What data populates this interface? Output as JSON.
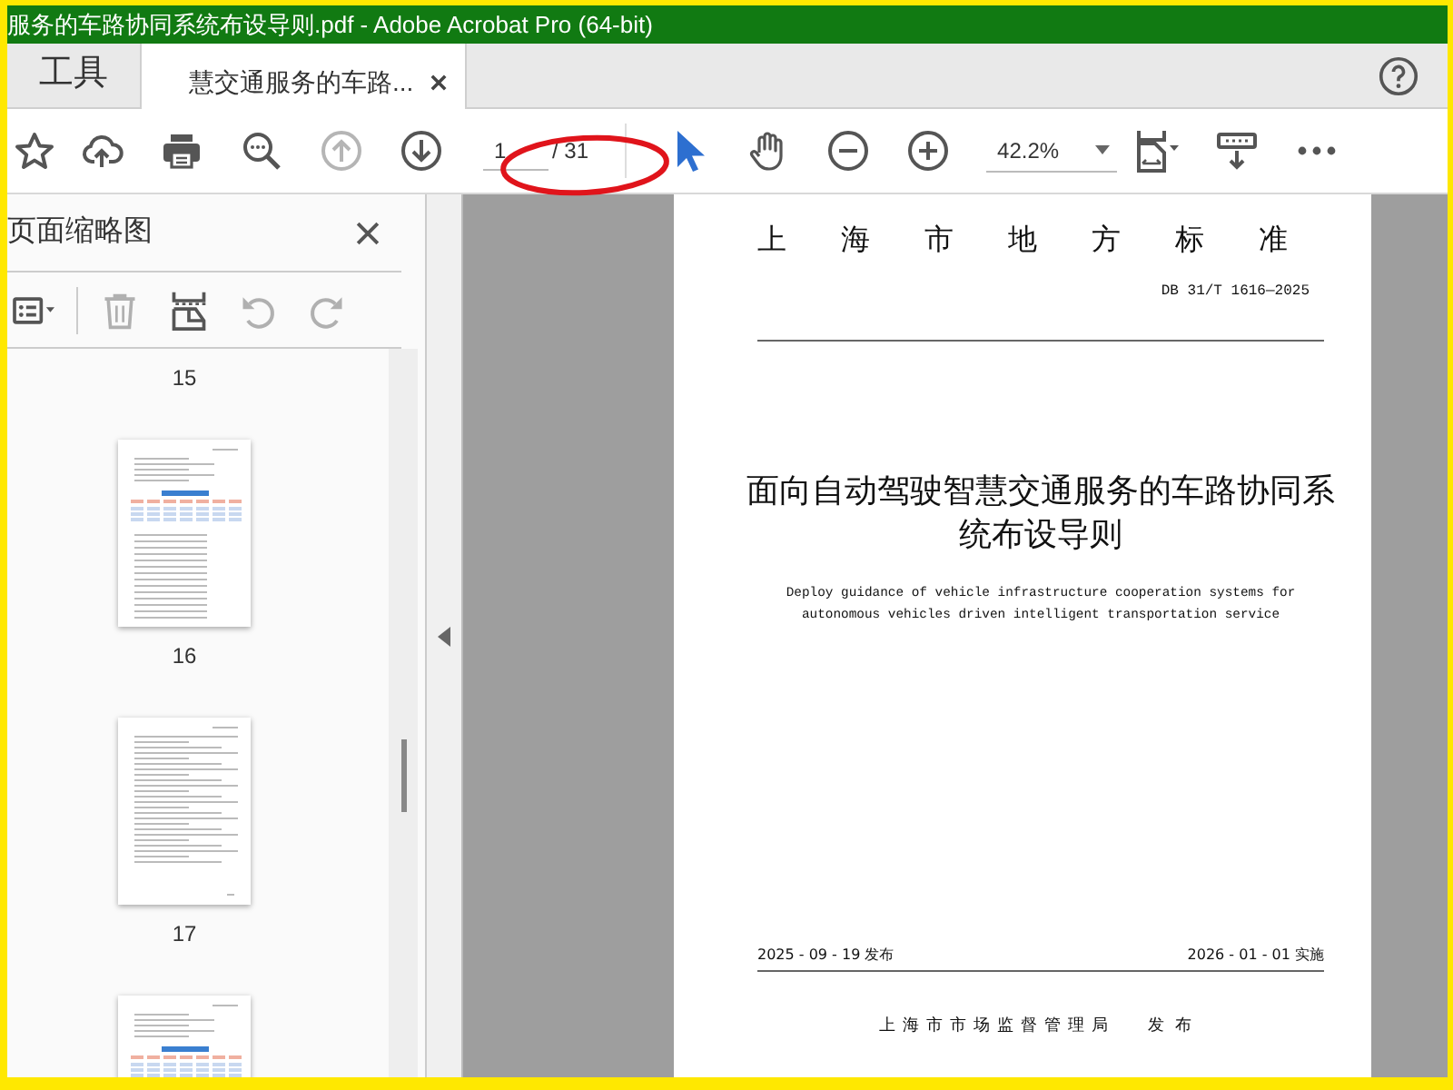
{
  "window": {
    "title": "服务的车路协同系统布设导则.pdf - Adobe Acrobat Pro (64-bit)"
  },
  "tabs": [
    {
      "label": "工具",
      "selected": false
    },
    {
      "label": "慧交通服务的车路...",
      "selected": true
    }
  ],
  "toolbar": {
    "items": [
      {
        "kind": "star",
        "disabled": false,
        "selected": false
      },
      {
        "kind": "upload",
        "disabled": false,
        "selected": false
      },
      {
        "kind": "print",
        "disabled": false,
        "selected": false
      },
      {
        "kind": "find",
        "disabled": false,
        "selected": false
      },
      {
        "kind": "prevpage",
        "disabled": true,
        "selected": false
      },
      {
        "kind": "nextpage",
        "disabled": false,
        "selected": false
      },
      {
        "kind": "pagefield",
        "value": "1",
        "total": "/ 31"
      },
      {
        "kind": "divider"
      },
      {
        "kind": "pointer",
        "disabled": false,
        "selected": true
      },
      {
        "kind": "hand",
        "disabled": false,
        "selected": false
      },
      {
        "kind": "zoomout",
        "disabled": false,
        "selected": false
      },
      {
        "kind": "zoomin",
        "disabled": false,
        "selected": false
      },
      {
        "kind": "zoomfield",
        "value": "42.2%"
      },
      {
        "kind": "fit",
        "disabled": false,
        "selected": false
      },
      {
        "kind": "keyboard",
        "disabled": false,
        "selected": false
      },
      {
        "kind": "more",
        "disabled": false,
        "selected": false
      }
    ]
  },
  "sidebar": {
    "title": "页面缩略图",
    "tools": [
      {
        "kind": "options",
        "disabled": false
      },
      {
        "kind": "trash",
        "disabled": true
      },
      {
        "kind": "insert",
        "disabled": false
      },
      {
        "kind": "undo",
        "disabled": true
      },
      {
        "kind": "redo",
        "disabled": true
      }
    ],
    "pages": [
      {
        "number": "15",
        "kind": "label"
      },
      {
        "number": "16",
        "kind": "table"
      },
      {
        "number": "17",
        "kind": "text"
      },
      {
        "kind": "table"
      }
    ]
  },
  "document": {
    "heading": "上海市地方标准",
    "code": "DB 31/T 1616—2025",
    "title": "面向自动驾驶智慧交通服务的车路协同系统布设导则",
    "subtitle": "Deploy guidance of vehicle infrastructure cooperation systems for autonomous vehicles driven intelligent transportation service",
    "issued": "2025 - 09 - 19 发布",
    "effective": "2026 - 01 - 01 实施",
    "publisher": "上海市市场监督管理局",
    "publisher_action": "发布"
  }
}
